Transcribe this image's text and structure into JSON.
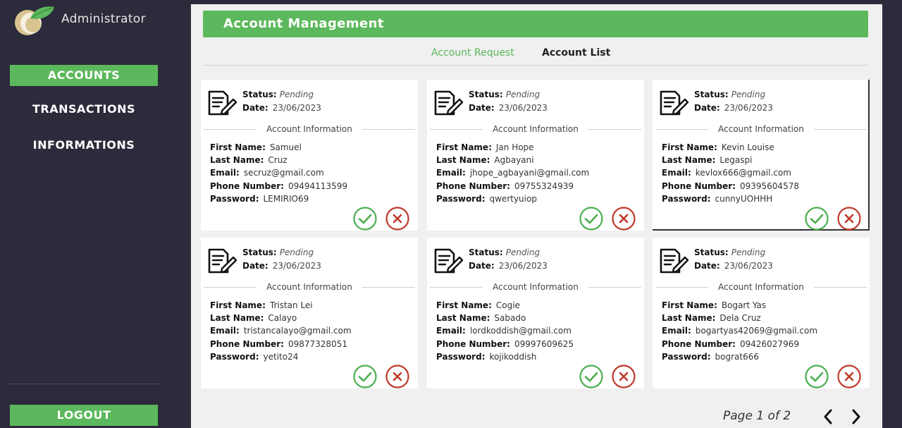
{
  "sidebar": {
    "title": "Administrator",
    "nav": [
      {
        "label": "ACCOUNTS",
        "active": true
      },
      {
        "label": "TRANSACTIONS",
        "active": false
      },
      {
        "label": "INFORMATIONS",
        "active": false
      }
    ],
    "logout_label": "LOGOUT",
    "logo_icon": "coin-leaf-logo"
  },
  "main": {
    "title": "Account Management",
    "tabs": [
      {
        "label": "Account Request",
        "active": true
      },
      {
        "label": "Account List",
        "active": false
      }
    ],
    "card_labels": {
      "status": "Status:",
      "date": "Date:",
      "section": "Account Information",
      "first_name": "First Name:",
      "last_name": "Last Name:",
      "email": "Email:",
      "phone": "Phone Number:",
      "password": "Password:"
    },
    "cards": [
      {
        "status": "Pending",
        "date": "23/06/2023",
        "first_name": "Samuel",
        "last_name": "Cruz",
        "email": "secruz@gmail.com",
        "phone": "09494113599",
        "password": "LEMIRIO69"
      },
      {
        "status": "Pending",
        "date": "23/06/2023",
        "first_name": "Jan Hope",
        "last_name": "Agbayani",
        "email": "jhope_agbayani@gmail.com",
        "phone": "09755324939",
        "password": "qwertyuiop"
      },
      {
        "status": "Pending",
        "date": "23/06/2023",
        "first_name": "Kevin Louise",
        "last_name": "Legaspi",
        "email": "kevlox666@gmail.com",
        "phone": "09395604578",
        "password": "cunnyUOHHH"
      },
      {
        "status": "Pending",
        "date": "23/06/2023",
        "first_name": "Tristan Lei",
        "last_name": "Calayo",
        "email": "tristancalayo@gmail.com",
        "phone": "09877328051",
        "password": "yetito24"
      },
      {
        "status": "Pending",
        "date": "23/06/2023",
        "first_name": "Cogie",
        "last_name": "Sabado",
        "email": "lordkoddish@gmail.com",
        "phone": "09997609625",
        "password": "kojikoddish"
      },
      {
        "status": "Pending",
        "date": "23/06/2023",
        "first_name": "Bogart Yas",
        "last_name": "Dela Cruz",
        "email": "bogartyas42069@gmail.com",
        "phone": "09426027969",
        "password": "bograt666"
      }
    ],
    "pagination": {
      "label": "Page 1 of 2"
    }
  },
  "colors": {
    "accent": "#5cb85c",
    "sidebar_bg": "#2b2b3b",
    "accept": "#4caf50",
    "reject": "#c0392b"
  }
}
